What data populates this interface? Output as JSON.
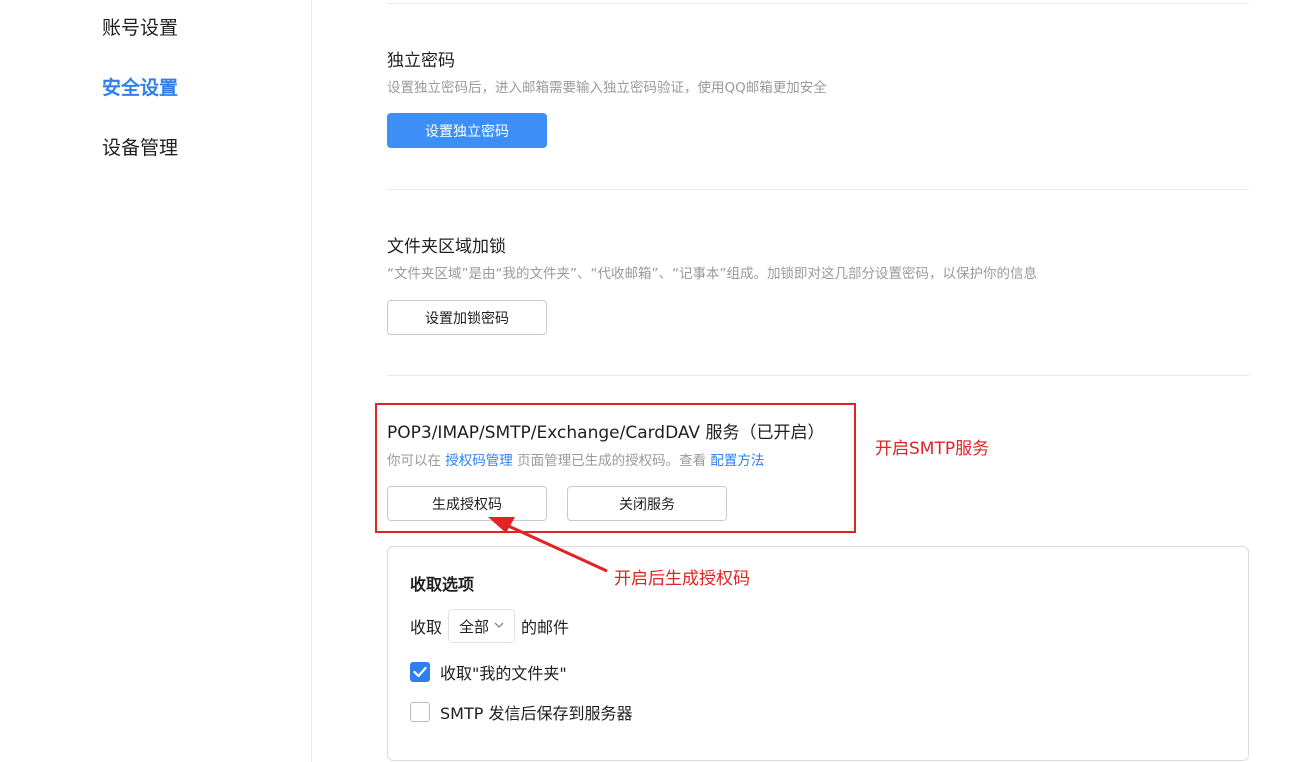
{
  "sidebar": {
    "items": [
      {
        "label": "账号设置",
        "active": false
      },
      {
        "label": "安全设置",
        "active": true
      },
      {
        "label": "设备管理",
        "active": false
      }
    ]
  },
  "sections": {
    "independent_password": {
      "title": "独立密码",
      "desc": "设置独立密码后，进入邮箱需要输入独立密码验证，使用QQ邮箱更加安全",
      "button": "设置独立密码"
    },
    "folder_lock": {
      "title": "文件夹区域加锁",
      "desc": "“文件夹区域”是由“我的文件夹”、“代收邮箱”、“记事本”组成。加锁即对这几部分设置密码，以保护你的信息",
      "button": "设置加锁密码"
    },
    "pop3_service": {
      "title": "POP3/IMAP/SMTP/Exchange/CardDAV 服务（已开启）",
      "desc_prefix": "你可以在",
      "link_auth": "授权码管理",
      "desc_middle": "页面管理已生成的授权码。查看",
      "link_config": "配置方法",
      "btn_generate": "生成授权码",
      "btn_close": "关闭服务"
    }
  },
  "fetch_options": {
    "title": "收取选项",
    "row_prefix": "收取",
    "select_value": "全部",
    "row_suffix": "的邮件",
    "checkbox_folder": {
      "label": "收取\"我的文件夹\"",
      "checked": true
    },
    "checkbox_smtp": {
      "label": "SMTP 发信后保存到服务器",
      "checked": false
    }
  },
  "annotations": {
    "smtp_note": "开启SMTP服务",
    "auth_note": "开启后生成授权码"
  },
  "colors": {
    "accent": "#2f7ff0",
    "primary_button": "#3d8ef5",
    "annotation": "#e02424"
  }
}
